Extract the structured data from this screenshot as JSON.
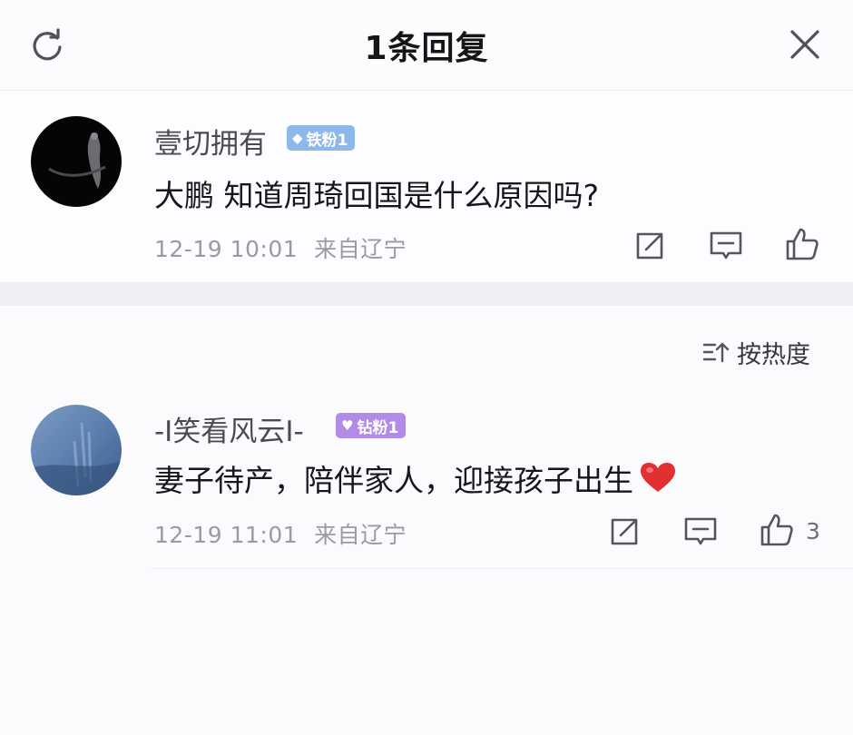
{
  "header": {
    "title": "1条回复"
  },
  "original_post": {
    "username": "壹切拥有",
    "fan_badge": "铁粉1",
    "fan_badge_color": "#8fb8ea",
    "text": "大鹏  知道周琦回国是什么原因吗?",
    "date": "12-19 10:01",
    "location": "来自辽宁"
  },
  "sort": {
    "label": "按热度"
  },
  "replies": [
    {
      "username": "-I笑看风云I-",
      "fan_badge": "钻粉1",
      "fan_badge_color": "#b28ae8",
      "text": "妻子待产，陪伴家人，迎接孩子出生",
      "date": "12-19 11:01",
      "location": "来自辽宁",
      "like_count": "3"
    }
  ],
  "icons": {
    "refresh": "refresh-icon",
    "close": "close-icon",
    "repost": "repost-icon",
    "comment": "comment-icon",
    "like": "thumbs-up-icon",
    "sort": "sort-icon",
    "heart": "red-heart-icon"
  },
  "colors": {
    "meta_text": "#9a9aa3",
    "divider_band": "#eeeef3",
    "heart": "#e23030"
  }
}
